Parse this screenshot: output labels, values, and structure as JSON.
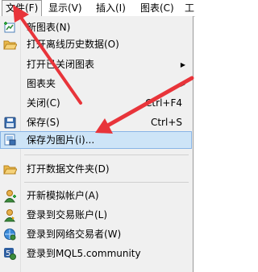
{
  "menubar": {
    "file": "文件(F)",
    "view": "显示(V)",
    "insert": "插入(I)",
    "charts": "图表(C)",
    "more": "工"
  },
  "menu": {
    "new_chart": "新图表(N)",
    "open_offline": "打开离线历史数据(O)",
    "open_closed": "打开已关闭图表",
    "profiles": "图表夹",
    "close": "关闭(C)",
    "close_shortcut": "Ctrl+F4",
    "save": "保存(S)",
    "save_shortcut": "Ctrl+S",
    "save_as_picture": "保存为图片(i)...",
    "open_data_folder": "打开数据文件夹(D)",
    "open_demo": "开新模拟帐户(A)",
    "login_trade": "登录到交易账户(L)",
    "login_web": "登录到网络交易者(W)",
    "login_mql5": "登录到MQL5.community"
  },
  "colors": {
    "annotation_arrow": "#e8343a",
    "highlight": "#cde4f7"
  }
}
